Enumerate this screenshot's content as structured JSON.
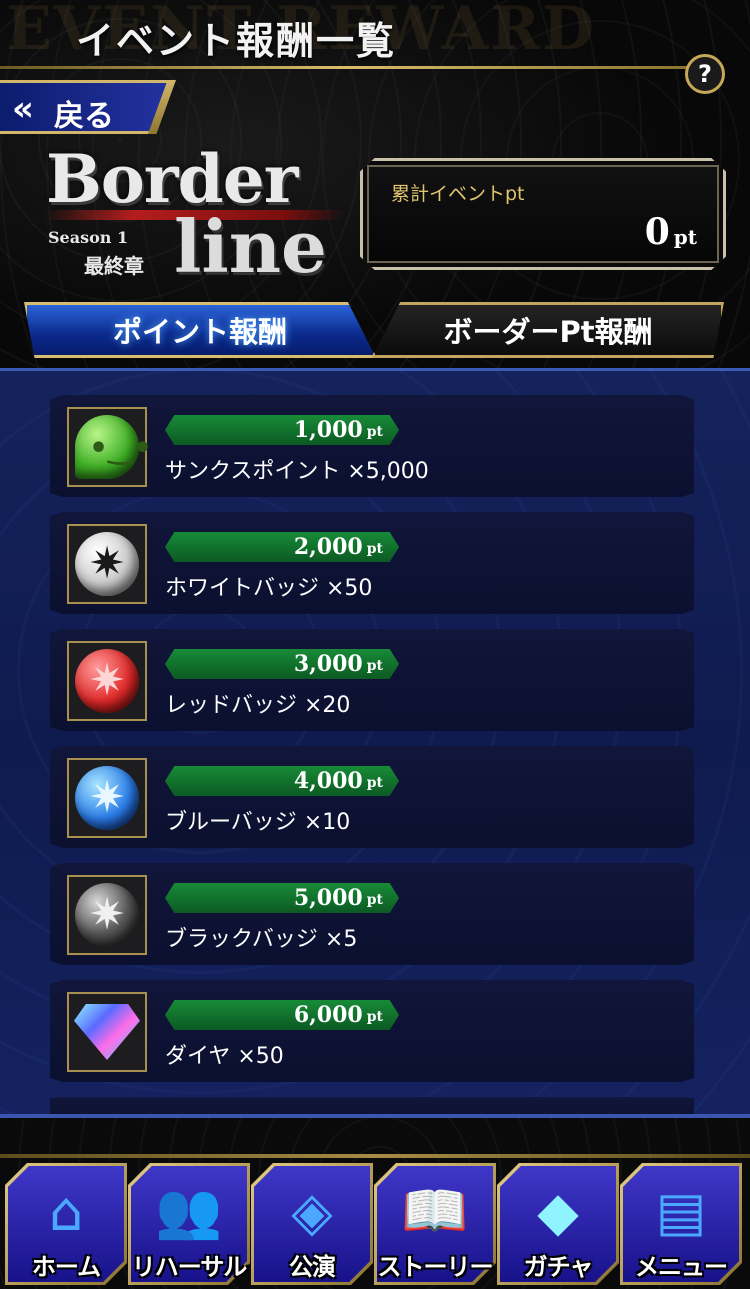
{
  "header": {
    "title": "イベント報酬一覧",
    "watermark": "EVENT REWARD",
    "help_label": "?",
    "back_label": "戻る",
    "back_icon": "double-chevron-left-icon"
  },
  "logo": {
    "word1": "Border",
    "word2": "line",
    "season": "Season 1",
    "chapter": "最終章"
  },
  "points_box": {
    "label": "累計イベントpt",
    "value": "0",
    "unit": "pt"
  },
  "tabs": [
    {
      "label": "ポイント報酬",
      "active": true
    },
    {
      "label": "ボーダーPt報酬",
      "active": false
    }
  ],
  "rewards": [
    {
      "points": "1,000",
      "unit": "pt",
      "name": "サンクスポイント ×5,000",
      "icon": "chat-face-icon"
    },
    {
      "points": "2,000",
      "unit": "pt",
      "name": "ホワイトバッジ ×50",
      "icon": "white-badge-icon"
    },
    {
      "points": "3,000",
      "unit": "pt",
      "name": "レッドバッジ ×20",
      "icon": "red-badge-icon"
    },
    {
      "points": "4,000",
      "unit": "pt",
      "name": "ブルーバッジ ×10",
      "icon": "blue-badge-icon"
    },
    {
      "points": "5,000",
      "unit": "pt",
      "name": "ブラックバッジ ×5",
      "icon": "black-badge-icon"
    },
    {
      "points": "6,000",
      "unit": "pt",
      "name": "ダイヤ ×50",
      "icon": "diamond-icon"
    }
  ],
  "nav": [
    {
      "label": "ホーム",
      "icon": "home-icon"
    },
    {
      "label": "リハーサル",
      "icon": "people-icon"
    },
    {
      "label": "公演",
      "icon": "stage-icon"
    },
    {
      "label": "ストーリー",
      "icon": "book-icon"
    },
    {
      "label": "ガチャ",
      "icon": "diamond-icon"
    },
    {
      "label": "メニュー",
      "icon": "notepad-icon"
    }
  ],
  "colors": {
    "gold": "#d2b66a",
    "list_bg": "#12205a",
    "points_ribbon": "#178b37",
    "accent_blue": "#2b63d8"
  }
}
